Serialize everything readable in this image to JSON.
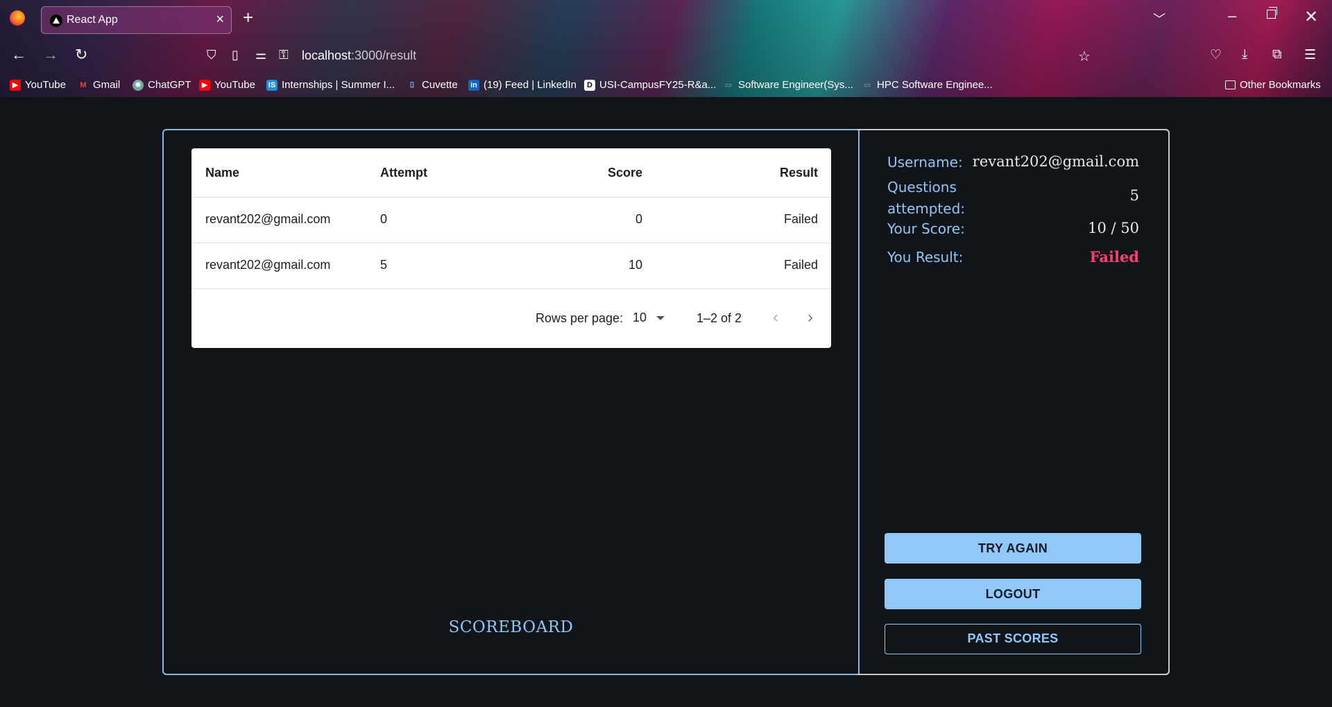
{
  "browser": {
    "tab_title": "React App",
    "url_host": "localhost",
    "url_path": ":3000/result",
    "bookmarks": [
      {
        "label": "YouTube",
        "icon": "youtube-icon",
        "color": "#ff0000"
      },
      {
        "label": "Gmail",
        "icon": "gmail-icon",
        "color": "#ea4335"
      },
      {
        "label": "ChatGPT",
        "icon": "chatgpt-icon",
        "color": "#74aa9c"
      },
      {
        "label": "YouTube",
        "icon": "youtube-icon",
        "color": "#ff0000"
      },
      {
        "label": "Internships | Summer I...",
        "icon": "internshala-icon",
        "color": "#1b8fe0"
      },
      {
        "label": "Cuvette",
        "icon": "cuvette-icon",
        "color": "#4a6cf7"
      },
      {
        "label": "(19) Feed | LinkedIn",
        "icon": "linkedin-icon",
        "color": "#0a66c2"
      },
      {
        "label": "USI-CampusFY25-R&a...",
        "icon": "dell-icon",
        "color": "#ffffff"
      },
      {
        "label": "Software Engineer(Sys...",
        "icon": "page-icon",
        "color": "#9aa0a6"
      },
      {
        "label": "HPC Software Enginee...",
        "icon": "page-icon",
        "color": "#9aa0a6"
      }
    ],
    "other_bookmarks": "Other Bookmarks"
  },
  "table": {
    "headers": [
      "Name",
      "Attempt",
      "Score",
      "Result"
    ],
    "rows": [
      [
        "revant202@gmail.com",
        "0",
        "0",
        "Failed"
      ],
      [
        "revant202@gmail.com",
        "5",
        "10",
        "Failed"
      ]
    ],
    "rows_per_page_label": "Rows per page:",
    "rows_per_page_value": "10",
    "range_label": "1–2 of 2"
  },
  "scoreboard_title": "SCOREBOARD",
  "summary": {
    "username_label": "Username:",
    "username_value": "revant202@gmail.com",
    "questions_label_1": "Questions",
    "questions_label_2": "attempted:",
    "questions_value": "5",
    "score_label": "Your Score:",
    "score_value": "10 / 50",
    "result_label": "You Result:",
    "result_value": "Failed"
  },
  "buttons": {
    "try_again": "TRY AGAIN",
    "logout": "LOGOUT",
    "past_scores": "PAST SCORES"
  },
  "colors": {
    "background": "#111419",
    "accent": "#8fc6f5",
    "failed": "#ff3e70"
  }
}
